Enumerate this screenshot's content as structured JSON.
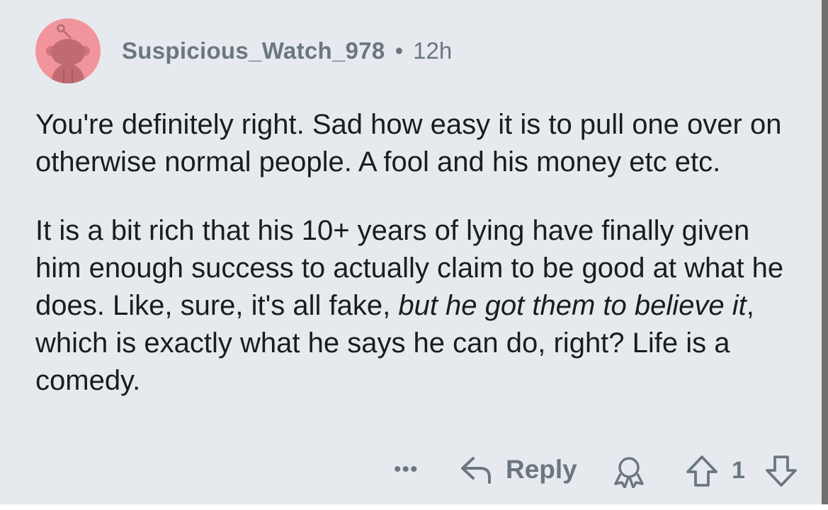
{
  "comment": {
    "username": "Suspicious_Watch_978",
    "separator": "•",
    "age": "12h",
    "paragraph1": "You're definitely right. Sad how easy it is to pull one over on otherwise normal people. A fool and his money etc etc.",
    "paragraph2_part1": "It is a bit rich that his 10+ years of lying have finally given him enough success to actually claim to be good at what he does. Like, sure, it's all fake, ",
    "paragraph2_italic": "but he got them to believe it",
    "paragraph2_part2": ", which is exactly what he says he can do, right? Life is a comedy."
  },
  "actions": {
    "more_label": "•••",
    "reply_label": "Reply",
    "vote_count": "1"
  },
  "icons": {
    "avatar": "snoo-avatar-icon",
    "reply": "reply-arrow-icon",
    "award": "award-icon",
    "upvote": "upvote-arrow-icon",
    "downvote": "downvote-arrow-icon",
    "more": "more-options-icon"
  },
  "colors": {
    "background": "#e6eaee",
    "avatar_bg": "#f2949c",
    "meta_text": "#6b7780",
    "body_text": "#1c1c1c"
  }
}
